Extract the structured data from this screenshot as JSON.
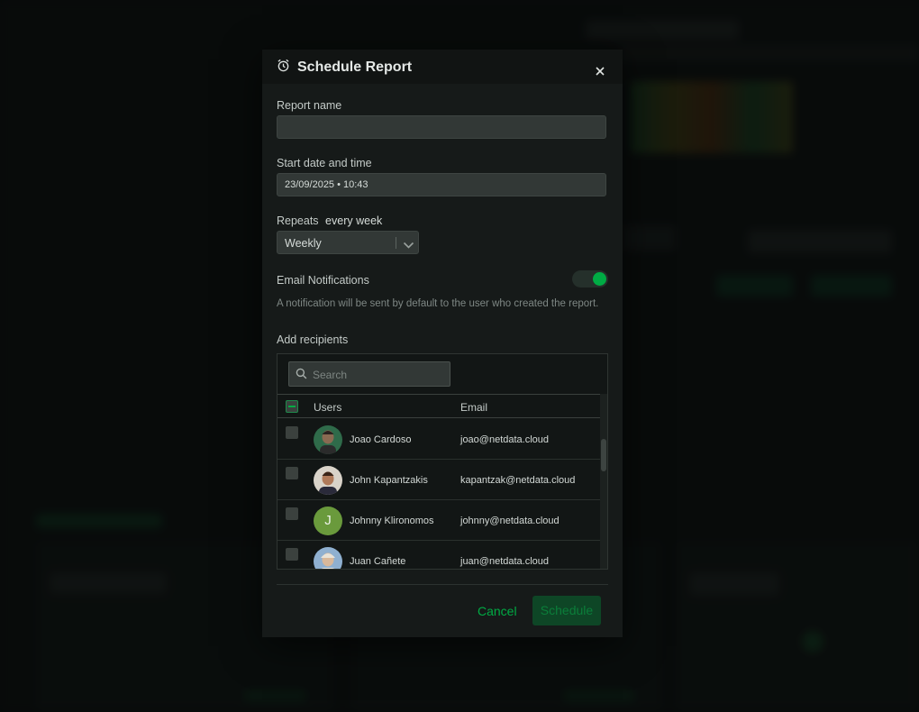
{
  "modal": {
    "title": "Schedule Report",
    "title_icon": "alarm-clock-icon",
    "close_icon": "close-icon",
    "report_name": {
      "label": "Report name",
      "value": ""
    },
    "start_date": {
      "label": "Start date and time",
      "value": "23/09/2025 • 10:43"
    },
    "repeats": {
      "label": "Repeats",
      "summary": "every week",
      "selected": "Weekly"
    },
    "email_notifications": {
      "label": "Email Notifications",
      "enabled": true,
      "help_text": "A notification will be sent by default to the user who created the report."
    },
    "recipients": {
      "label": "Add recipients",
      "search_placeholder": "Search",
      "columns": {
        "users": "Users",
        "email": "Email"
      },
      "rows": [
        {
          "name": "Joao Cardoso",
          "email": "joao@netdata.cloud",
          "avatar": "photo",
          "checked": false
        },
        {
          "name": "John Kapantzakis",
          "email": "kapantzak@netdata.cloud",
          "avatar": "photo",
          "checked": false
        },
        {
          "name": "Johnny Klironomos",
          "email": "johnny@netdata.cloud",
          "avatar": "J",
          "avatar_color": "#6a9a3c",
          "checked": false
        },
        {
          "name": "Juan Cañete",
          "email": "juan@netdata.cloud",
          "avatar": "photo",
          "checked": false
        }
      ]
    },
    "buttons": {
      "cancel": "Cancel",
      "schedule": "Schedule"
    },
    "colors": {
      "accent": "#00ab44",
      "modal_bg": "#161a19",
      "input_bg": "#323836"
    }
  }
}
